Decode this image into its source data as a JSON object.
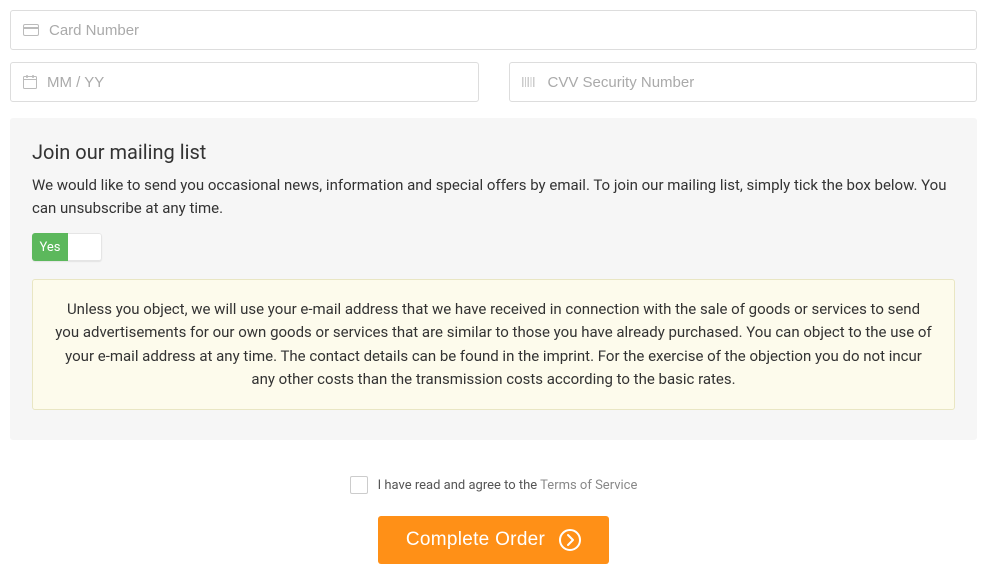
{
  "payment": {
    "card_number_placeholder": "Card Number",
    "expiry_placeholder": "MM / YY",
    "cvv_placeholder": "CVV Security Number"
  },
  "mailing": {
    "title": "Join our mailing list",
    "description": "We would like to send you occasional news, information and special offers by email. To join our mailing list, simply tick the box below. You can unsubscribe at any time.",
    "toggle_yes": "Yes",
    "notice": "Unless you object, we will use your e-mail address that we have received in connection with the sale of goods or services to send you advertisements for our own goods or services that are similar to those you have already purchased. You can object to the use of your e-mail address at any time. The contact details can be found in the imprint. For the exercise of the objection you do not incur any other costs than the transmission costs according to the basic rates."
  },
  "terms": {
    "prefix": "I have read and agree to the ",
    "link_label": "Terms of Service"
  },
  "submit": {
    "label": "Complete Order"
  }
}
